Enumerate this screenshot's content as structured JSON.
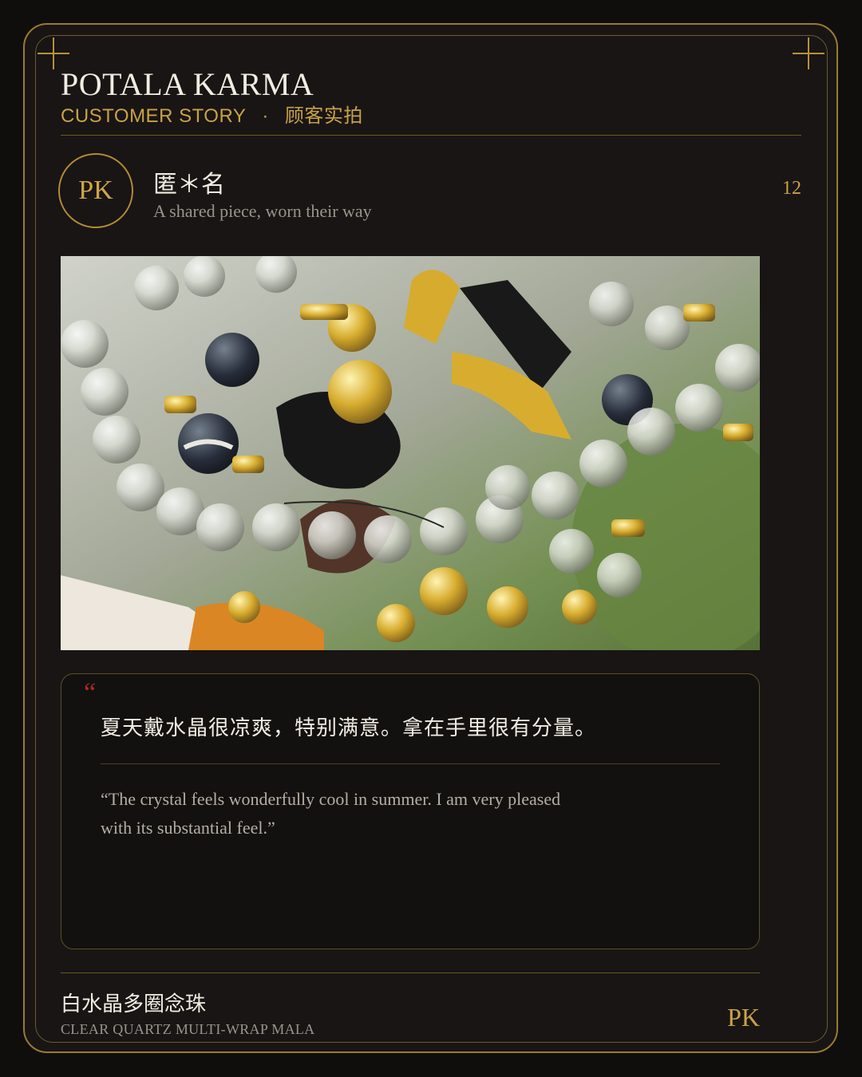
{
  "header": {
    "brand": "POTALA KARMA",
    "subtitle_en": "CUSTOMER STORY",
    "subtitle_sep": "·",
    "subtitle_zh": "顾客实拍"
  },
  "reviewer": {
    "avatar_text": "PK",
    "name": "匿＊名",
    "tagline": "A shared piece, worn their way",
    "count": "12"
  },
  "photo": {
    "subject": "clear quartz multi-wrap mala with gold-tone accents and black tassels in a clear bag"
  },
  "quote": {
    "mark": "“",
    "text_zh": "夏天戴水晶很凉爽，特别满意。拿在手里很有分量。",
    "text_en": "“The crystal feels wonderfully cool in summer. I am very pleased with its substantial feel.”"
  },
  "footer": {
    "product_zh": "白水晶多圈念珠",
    "product_en": "CLEAR QUARTZ MULTI-WRAP MALA",
    "mark": "PK"
  },
  "colors": {
    "background": "#0f0e0d",
    "card": "#181514",
    "gold": "#c9a246",
    "text": "#f1ece2",
    "muted": "#9a948a",
    "quote_mark": "#b22a22"
  }
}
